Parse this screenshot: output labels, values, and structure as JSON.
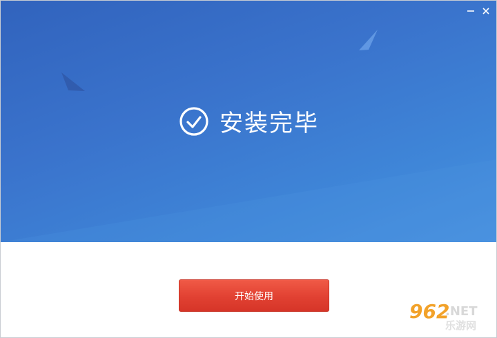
{
  "window": {
    "status_title": "安装完毕",
    "start_button_label": "开始使用"
  },
  "controls": {
    "minimize_symbol": "—",
    "close_symbol": "✕"
  },
  "watermark": {
    "number": "962",
    "suffix": ".NET",
    "site_cn": "乐游网"
  },
  "colors": {
    "banner_top": "#3163bd",
    "banner_bottom": "#4a92e0",
    "button": "#e14132",
    "watermark_orange": "#f2a22a"
  },
  "icons": [
    "check-circle-icon",
    "minimize-icon",
    "close-icon"
  ]
}
